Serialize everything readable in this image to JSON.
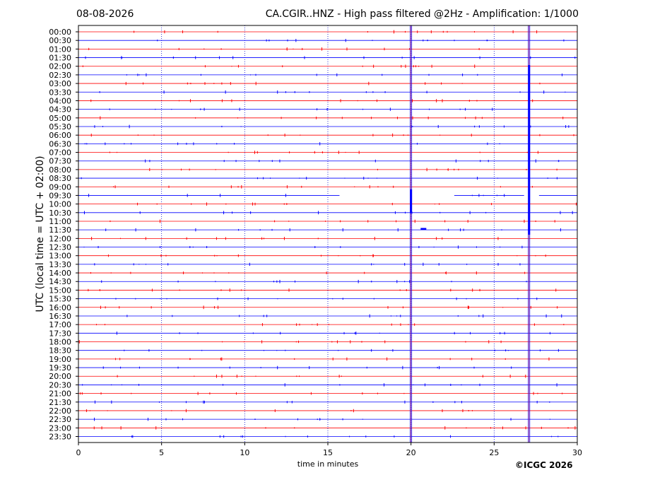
{
  "header": {
    "date": "08-08-2026",
    "title": "CA.CGIR..HNZ - High pass filtered @2Hz - Amplification: 1/1000"
  },
  "footer": {
    "copyright": "©ICGC 2026"
  },
  "chart_data": {
    "type": "line",
    "title": "CA.CGIR..HNZ - High pass filtered @2Hz - Amplification: 1/1000",
    "xlabel": "time in minutes",
    "ylabel": "UTC (local time = UTC + 02:00)",
    "xlim": [
      0,
      30
    ],
    "x_ticks": [
      0,
      5,
      10,
      15,
      20,
      25,
      30
    ],
    "grid": "vertical dotted lines at 5, 10, 15, 20, 25",
    "trace_colors": [
      "#ff0000",
      "#0000ff"
    ],
    "row_labels": [
      "00:00",
      "00:30",
      "01:00",
      "01:30",
      "02:00",
      "02:30",
      "03:00",
      "03:30",
      "04:00",
      "04:30",
      "05:00",
      "05:30",
      "06:00",
      "06:30",
      "07:00",
      "07:30",
      "08:00",
      "08:30",
      "09:00",
      "09:30",
      "10:00",
      "10:30",
      "11:00",
      "11:30",
      "12:00",
      "12:30",
      "13:00",
      "13:30",
      "14:00",
      "14:30",
      "15:00",
      "15:30",
      "16:00",
      "16:30",
      "17:00",
      "17:30",
      "18:00",
      "18:30",
      "19:00",
      "19:30",
      "20:00",
      "20:30",
      "21:00",
      "21:30",
      "22:00",
      "22:30",
      "23:00",
      "23:30"
    ],
    "events": [
      {
        "minute": 20.0,
        "from_row": "00:00",
        "to_row": "23:30",
        "description": "persistent vertical spike"
      },
      {
        "minute": 27.1,
        "from_row": "00:00",
        "to_row": "23:30",
        "description": "persistent vertical spike"
      }
    ],
    "gaps": [
      {
        "row": "09:30",
        "from_minute": 15.7,
        "to_minute": 22.6
      },
      {
        "row": "09:30",
        "from_minute": 26.8,
        "to_minute": 27.7
      }
    ]
  }
}
